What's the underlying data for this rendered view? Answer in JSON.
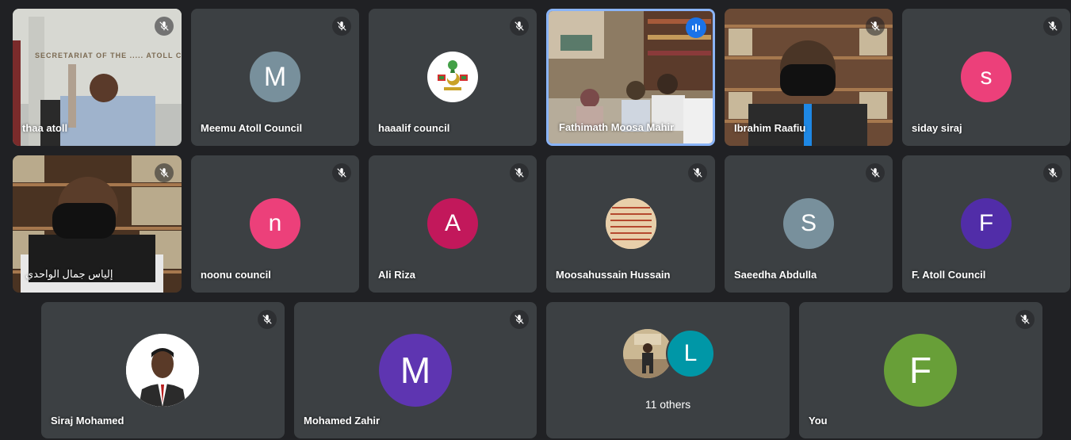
{
  "tiles": {
    "thaa": {
      "name": "thaa atoll",
      "banner": "SECRETARIAT OF THE ..... ATOLL COUNCIL"
    },
    "meemu": {
      "name": "Meemu Atoll Council",
      "initial": "M",
      "color": "#78909c"
    },
    "haalif": {
      "name": "haaalif council"
    },
    "fathimath": {
      "name": "Fathimath Moosa Mahir"
    },
    "ibrahim": {
      "name": "Ibrahim Raafiu"
    },
    "siday": {
      "name": "siday siraj",
      "initial": "s",
      "color": "#ec407a"
    },
    "ilyas": {
      "name": "إلياس جمال الواحدي"
    },
    "noonu": {
      "name": "noonu council",
      "initial": "n",
      "color": "#ec407a"
    },
    "ali": {
      "name": "Ali Riza",
      "initial": "A",
      "color": "#c2185b"
    },
    "moosahussain": {
      "name": "Moosahussain Hussain"
    },
    "saeedha": {
      "name": "Saeedha Abdulla",
      "initial": "S",
      "color": "#78909c"
    },
    "fatoll": {
      "name": "F. Atoll Council",
      "initial": "F",
      "color": "#512da8"
    },
    "siraj": {
      "name": "Siraj Mohamed"
    },
    "zahir": {
      "name": "Mohamed Zahir",
      "initial": "M",
      "color": "#5e35b1"
    },
    "others": {
      "label": "11 others",
      "initial": "L",
      "color": "#0097a7"
    },
    "you": {
      "name": "You",
      "initial": "F",
      "color": "#689f38"
    }
  },
  "icons": {
    "mic_muted": "mic-off-icon",
    "speaking": "audio-level-icon"
  }
}
